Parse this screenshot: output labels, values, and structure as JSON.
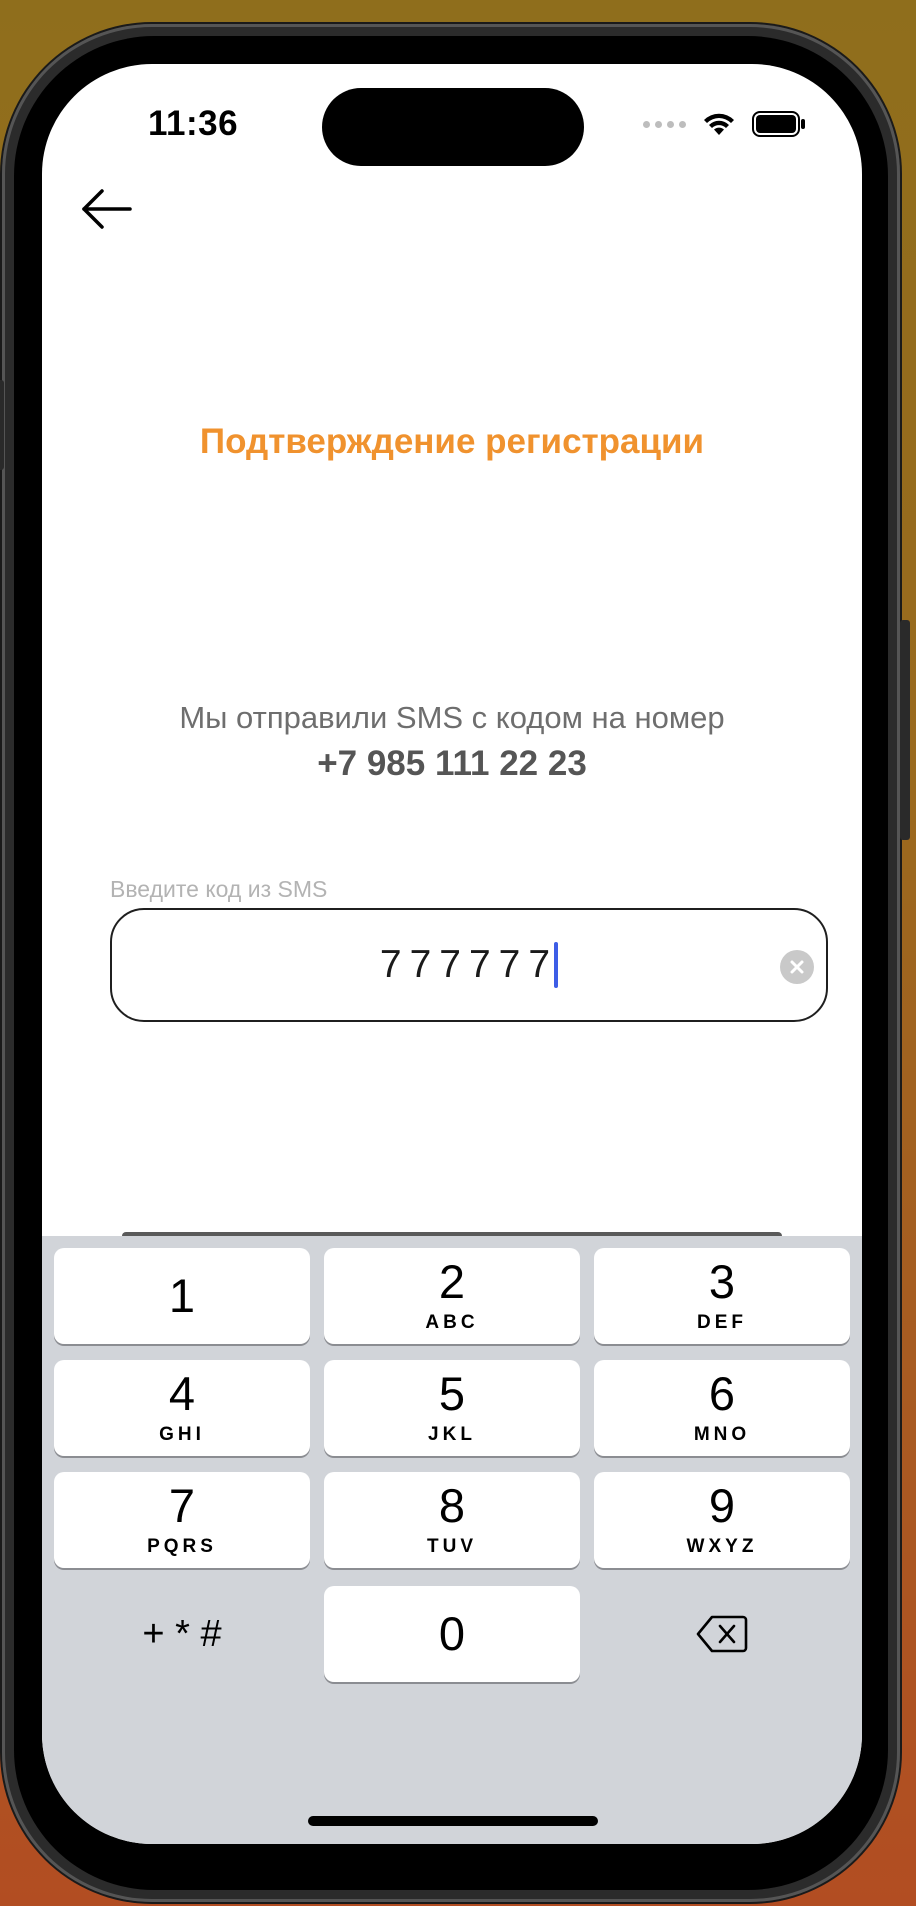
{
  "status_bar": {
    "time": "11:36"
  },
  "header": {
    "back_icon": "arrow-left-icon"
  },
  "title": "Подтверждение регистрации",
  "message": {
    "text": "Мы отправили SMS с кодом на номер",
    "phone": "+7 985 111 22 23"
  },
  "code_input": {
    "label": "Введите код из SMS",
    "value": "777777",
    "clear_icon": "clear-x-icon"
  },
  "keypad": {
    "keys": [
      {
        "digit": "1",
        "letters": ""
      },
      {
        "digit": "2",
        "letters": "ABC"
      },
      {
        "digit": "3",
        "letters": "DEF"
      },
      {
        "digit": "4",
        "letters": "GHI"
      },
      {
        "digit": "5",
        "letters": "JKL"
      },
      {
        "digit": "6",
        "letters": "MNO"
      },
      {
        "digit": "7",
        "letters": "PQRS"
      },
      {
        "digit": "8",
        "letters": "TUV"
      },
      {
        "digit": "9",
        "letters": "WXYZ"
      },
      {
        "digit": "0",
        "letters": ""
      }
    ],
    "symbols": "+ * #",
    "delete_icon": "backspace-icon"
  },
  "colors": {
    "accent": "#f0922e",
    "caret": "#3d5de6",
    "keyboard_bg": "#d1d4d9"
  }
}
